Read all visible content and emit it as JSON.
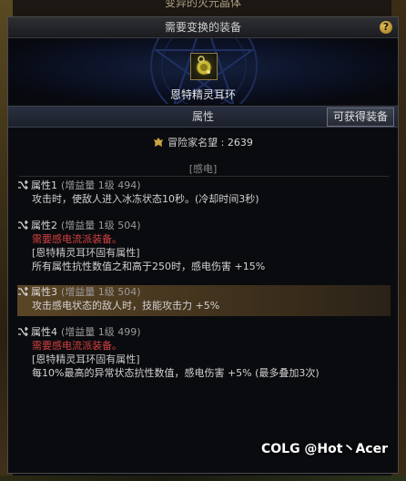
{
  "background": {
    "title": "变异的灭元晶体"
  },
  "header": {
    "title": "需要变换的装备",
    "help_label": "?"
  },
  "item": {
    "name": "恩特精灵耳环",
    "icon": "earring-icon"
  },
  "attributes_bar": {
    "title": "属性",
    "obtain_button": "可获得装备"
  },
  "fame": {
    "label": "冒险家名望 :",
    "value": "2639"
  },
  "section_label": "[感电]",
  "attributes": [
    {
      "name": "属性1",
      "meta": "(增益量 1级 494)",
      "lines": [
        "攻击时，使敌人进入冰冻状态10秒。(冷却时间3秒)"
      ]
    },
    {
      "name": "属性2",
      "meta": "(增益量 1级 504)",
      "req": "需要感电流派装备。",
      "src": "[恩特精灵耳环固有属性]",
      "lines": [
        "所有属性抗性数值之和高于250时，感电伤害 +15%"
      ]
    },
    {
      "name": "属性3",
      "meta": "(增益量 1级 504)",
      "lines": [
        "攻击感电状态的敌人时，技能攻击力 +5%"
      ]
    },
    {
      "name": "属性4",
      "meta": "(增益量 1级 499)",
      "req": "需要感电流派装备。",
      "src": "[恩特精灵耳环固有属性]",
      "lines": [
        "每10%最高的异常状态抗性数值，感电伤害 +5%  (最多叠加3次)"
      ]
    }
  ],
  "watermark": "COLG  @Hot丶Acer",
  "colors": {
    "requirement": "#d64040",
    "highlight_row": "#5a4526",
    "panel_bg": "#0a0b0e"
  }
}
